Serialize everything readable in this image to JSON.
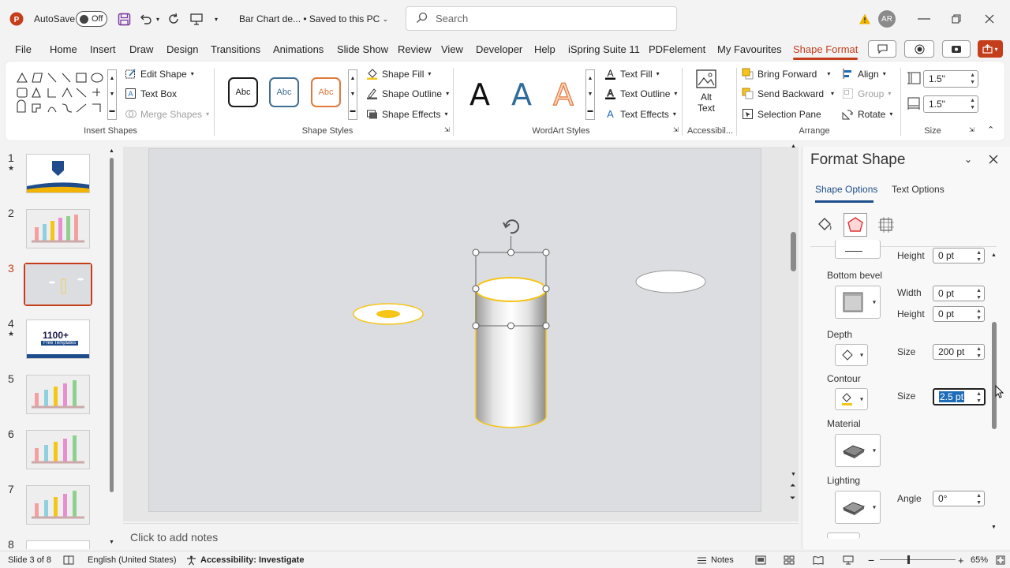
{
  "titlebar": {
    "autosave_label": "AutoSave",
    "autosave_state": "Off",
    "doc_title": "Bar Chart de...",
    "save_status": "• Saved to this PC",
    "search_placeholder": "Search",
    "user_initials": "AR"
  },
  "menu_tabs": [
    "File",
    "Home",
    "Insert",
    "Draw",
    "Design",
    "Transitions",
    "Animations",
    "Slide Show",
    "Review",
    "View",
    "Developer",
    "Help",
    "iSpring Suite 11",
    "PDFelement",
    "My Favourites",
    "Shape Format"
  ],
  "ribbon": {
    "insert_shapes": {
      "label": "Insert Shapes",
      "edit_shape": "Edit Shape",
      "text_box": "Text Box",
      "merge_shapes": "Merge Shapes"
    },
    "shape_styles": {
      "label": "Shape Styles",
      "sample": "Abc",
      "fill": "Shape Fill",
      "outline": "Shape Outline",
      "effects": "Shape Effects"
    },
    "wordart": {
      "label": "WordArt Styles",
      "glyph": "A",
      "text_fill": "Text Fill",
      "text_outline": "Text Outline",
      "text_effects": "Text Effects"
    },
    "accessibility": {
      "label": "Accessibil...",
      "alt_text_1": "Alt",
      "alt_text_2": "Text"
    },
    "arrange": {
      "label": "Arrange",
      "bring_forward": "Bring Forward",
      "send_backward": "Send Backward",
      "selection_pane": "Selection Pane",
      "align": "Align",
      "group": "Group",
      "rotate": "Rotate"
    },
    "size": {
      "label": "Size",
      "height": "1.5\"",
      "width": "1.5\""
    }
  },
  "slides": [
    {
      "num": "1",
      "star": "★"
    },
    {
      "num": "2",
      "star": ""
    },
    {
      "num": "3",
      "star": ""
    },
    {
      "num": "4",
      "star": "★"
    },
    {
      "num": "5",
      "star": ""
    },
    {
      "num": "6",
      "star": ""
    },
    {
      "num": "7",
      "star": ""
    },
    {
      "num": "8",
      "star": ""
    }
  ],
  "thumb4_text": {
    "big": "1100+",
    "small": "Free Templates"
  },
  "notes_placeholder": "Click to add notes",
  "pane": {
    "title": "Format Shape",
    "tab_shape": "Shape Options",
    "tab_text": "Text Options",
    "top_height_label": "Height",
    "top_height_value": "0 pt",
    "bottom_bevel": "Bottom bevel",
    "width_label": "Width",
    "width_value": "0 pt",
    "height_label": "Height",
    "height_value": "0 pt",
    "depth": "Depth",
    "depth_size_label": "Size",
    "depth_size_value": "200 pt",
    "contour": "Contour",
    "contour_size_label": "Size",
    "contour_size_value": "2.5 pt",
    "material": "Material",
    "lighting": "Lighting",
    "angle_label": "Angle",
    "angle_value": "0°"
  },
  "status": {
    "slide_info": "Slide 3 of 8",
    "language": "English (United States)",
    "accessibility": "Accessibility: Investigate",
    "notes": "Notes",
    "zoom": "65%"
  },
  "colors": {
    "accent": "#c43e1c",
    "gold": "#f5c518",
    "warn": "#f0b400"
  }
}
